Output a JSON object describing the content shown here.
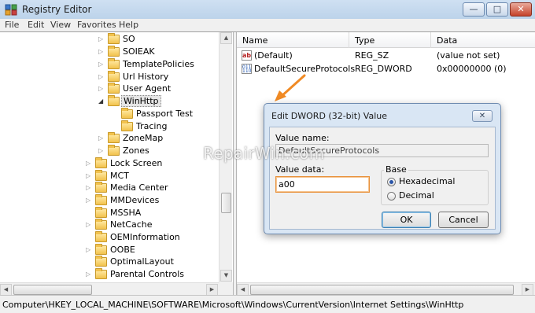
{
  "window": {
    "title": "Registry Editor",
    "buttons": {
      "minimize": "—",
      "maximize": "□",
      "close": "✕"
    }
  },
  "menu": [
    "File",
    "Edit",
    "View",
    "Favorites",
    "Help"
  ],
  "tree": {
    "nodes": [
      {
        "label": "SO",
        "expander": "▷"
      },
      {
        "label": "SOIEAK",
        "expander": "▷"
      },
      {
        "label": "TemplatePolicies",
        "expander": "▷"
      },
      {
        "label": "Url History",
        "expander": "▷"
      },
      {
        "label": "User Agent",
        "expander": "▷"
      },
      {
        "label": "WinHttp",
        "expander": "◢"
      },
      {
        "label": "Passport Test",
        "expander": ""
      },
      {
        "label": "Tracing",
        "expander": ""
      },
      {
        "label": "ZoneMap",
        "expander": "▷"
      },
      {
        "label": "Zones",
        "expander": "▷"
      },
      {
        "label": "Lock Screen",
        "expander": "▷"
      },
      {
        "label": "MCT",
        "expander": "▷"
      },
      {
        "label": "Media Center",
        "expander": "▷"
      },
      {
        "label": "MMDevices",
        "expander": "▷"
      },
      {
        "label": "MSSHA",
        "expander": ""
      },
      {
        "label": "NetCache",
        "expander": "▷"
      },
      {
        "label": "OEMInformation",
        "expander": ""
      },
      {
        "label": "OOBE",
        "expander": "▷"
      },
      {
        "label": "OptimalLayout",
        "expander": ""
      },
      {
        "label": "Parental Controls",
        "expander": "▷"
      }
    ]
  },
  "list": {
    "columns": [
      "Name",
      "Type",
      "Data"
    ],
    "rows": [
      {
        "name": "(Default)",
        "type": "REG_SZ",
        "data": "(value not set)",
        "icon": "ab"
      },
      {
        "name": "DefaultSecureProtocols",
        "type": "REG_DWORD",
        "data": "0x00000000 (0)",
        "icon": "011 110"
      }
    ]
  },
  "dialog": {
    "title": "Edit DWORD (32-bit) Value",
    "close": "✕",
    "value_name_label": "Value name:",
    "value_name": "DefaultSecureProtocols",
    "value_data_label": "Value data:",
    "value_data": "a00",
    "base_label": "Base",
    "base_options": [
      "Hexadecimal",
      "Decimal"
    ],
    "base_selected": "Hexadecimal",
    "ok": "OK",
    "cancel": "Cancel"
  },
  "watermark": "RepairWin.com",
  "status": "Computer\\HKEY_LOCAL_MACHINE\\SOFTWARE\\Microsoft\\Windows\\CurrentVersion\\Internet Settings\\WinHttp",
  "colors": {
    "accent_arrow": "#f08a24",
    "input_focus": "#e8913a",
    "selected_folder": "#e5e5e5"
  }
}
